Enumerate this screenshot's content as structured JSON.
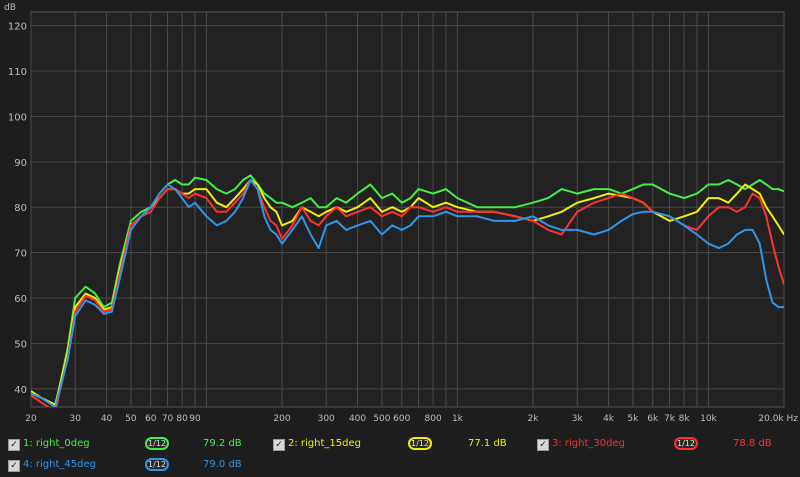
{
  "chart_data": {
    "type": "line",
    "x_unit": "Hz",
    "ylabel": "dB",
    "x_scale": "log",
    "xlim": [
      20,
      20000
    ],
    "ylim": [
      36,
      123
    ],
    "grid": true,
    "y_ticks": [
      40,
      50,
      60,
      70,
      80,
      90,
      100,
      110,
      120
    ],
    "x_tick_labels": [
      {
        "v": 20,
        "t": "20"
      },
      {
        "v": 30,
        "t": "30"
      },
      {
        "v": 40,
        "t": "40"
      },
      {
        "v": 50,
        "t": "50"
      },
      {
        "v": 60,
        "t": "60"
      },
      {
        "v": 70,
        "t": "70"
      },
      {
        "v": 80,
        "t": "80"
      },
      {
        "v": 90,
        "t": "90"
      },
      {
        "v": 200,
        "t": "200"
      },
      {
        "v": 300,
        "t": "300"
      },
      {
        "v": 400,
        "t": "400"
      },
      {
        "v": 500,
        "t": "500"
      },
      {
        "v": 600,
        "t": "600"
      },
      {
        "v": 800,
        "t": "800"
      },
      {
        "v": 1000,
        "t": "1k"
      },
      {
        "v": 2000,
        "t": "2k"
      },
      {
        "v": 3000,
        "t": "3k"
      },
      {
        "v": 4000,
        "t": "4k"
      },
      {
        "v": 5000,
        "t": "5k"
      },
      {
        "v": 6000,
        "t": "6k"
      },
      {
        "v": 7000,
        "t": "7k"
      },
      {
        "v": 8000,
        "t": "8k"
      },
      {
        "v": 10000,
        "t": "10k"
      },
      {
        "v": 20000,
        "t": "20.0k Hz"
      }
    ],
    "x_minor": [
      100,
      700,
      900,
      9000
    ],
    "x": [
      20,
      22,
      25,
      28,
      30,
      33,
      36,
      39,
      42,
      45,
      50,
      55,
      60,
      65,
      70,
      75,
      80,
      85,
      90,
      100,
      110,
      120,
      130,
      140,
      150,
      160,
      170,
      180,
      190,
      200,
      220,
      240,
      260,
      280,
      300,
      330,
      360,
      400,
      450,
      500,
      550,
      600,
      650,
      700,
      800,
      900,
      1000,
      1200,
      1400,
      1700,
      2000,
      2300,
      2600,
      3000,
      3500,
      4000,
      4500,
      5000,
      5500,
      6000,
      7000,
      8000,
      9000,
      10000,
      11000,
      12000,
      13000,
      14000,
      15000,
      16000,
      17000,
      18000,
      19000,
      20000
    ],
    "series": [
      {
        "name": "1: right_0deg",
        "color": "#44ee44",
        "smoothing": "1/12",
        "level": "79.2 dB",
        "values": [
          39,
          38,
          36,
          49,
          60,
          62.5,
          61,
          58,
          59,
          67,
          77,
          79,
          80,
          83,
          85,
          86,
          85,
          85,
          86.5,
          86,
          84,
          83,
          84,
          86,
          87,
          85,
          83,
          82,
          81,
          81,
          80,
          81,
          82,
          80,
          80,
          82,
          81,
          83,
          85,
          82,
          83,
          81,
          82,
          84,
          83,
          84,
          82,
          80,
          80,
          80,
          81,
          82,
          84,
          83,
          84,
          84,
          83,
          84,
          85,
          85,
          83,
          82,
          83,
          85,
          85,
          86,
          85,
          84,
          85,
          86,
          85,
          84,
          84,
          83.5
        ]
      },
      {
        "name": "2: right_15deg",
        "color": "#f0f000",
        "smoothing": "1/12",
        "level": "77.1 dB",
        "values": [
          39.5,
          38,
          36.5,
          48,
          58,
          61,
          60,
          57.5,
          58,
          66,
          76,
          78,
          80,
          82,
          84,
          84,
          83,
          83,
          84,
          84,
          81,
          80,
          82,
          84,
          86,
          85,
          82,
          80,
          79,
          76,
          77,
          80,
          79,
          78,
          79,
          80,
          79,
          80,
          82,
          79,
          80,
          79,
          80,
          82,
          80,
          81,
          80,
          79,
          79,
          78,
          77,
          78,
          79,
          81,
          82,
          83,
          82.5,
          82,
          81,
          79,
          77,
          78,
          79,
          82,
          82,
          81,
          83,
          85,
          84,
          83,
          80,
          78,
          76,
          74
        ]
      },
      {
        "name": "3: right_30deg",
        "color": "#ff3030",
        "smoothing": "1/12",
        "level": "78.8 dB",
        "values": [
          38.5,
          37,
          35,
          47,
          57,
          60.5,
          59.5,
          57,
          57.5,
          65,
          76,
          78,
          79,
          82,
          84,
          84,
          83,
          82,
          83,
          82,
          79,
          79,
          81,
          83,
          86,
          84,
          80,
          77,
          76,
          73,
          76,
          80,
          77,
          76,
          78,
          80,
          78,
          79,
          80,
          78,
          79,
          78,
          80,
          80,
          79,
          80,
          79,
          79,
          79,
          78,
          77,
          75,
          74,
          79,
          81,
          82,
          83,
          82,
          81,
          79,
          78,
          76,
          75,
          78,
          80,
          80,
          79,
          80,
          83,
          82,
          78,
          72,
          67,
          63
        ]
      },
      {
        "name": "4: right_45deg",
        "color": "#2f95e8",
        "smoothing": "1/12",
        "level": "79.0 dB",
        "values": [
          39,
          38,
          36,
          46.5,
          56,
          59.5,
          58.5,
          56.5,
          57,
          64,
          75,
          78,
          80,
          83,
          85,
          84,
          82,
          80,
          81,
          78,
          76,
          77,
          79,
          82,
          86,
          84,
          78,
          75,
          74,
          72,
          75,
          78,
          74,
          71,
          76,
          77,
          75,
          76,
          77,
          74,
          76,
          75,
          76,
          78,
          78,
          79,
          78,
          78,
          77,
          77,
          78,
          76,
          75,
          75,
          74,
          75,
          77,
          78.5,
          79,
          79,
          78,
          76,
          74,
          72,
          71,
          72,
          74,
          75,
          75,
          72,
          64,
          59,
          58,
          58
        ]
      }
    ]
  }
}
